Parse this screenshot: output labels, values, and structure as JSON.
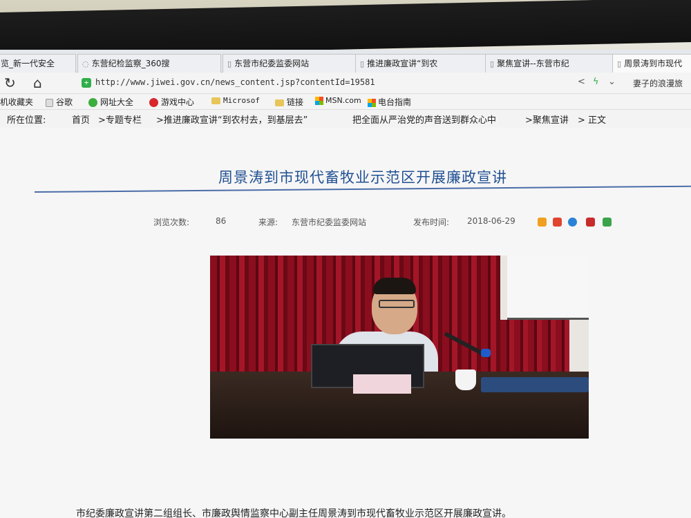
{
  "tabs": [
    {
      "label": "览_新一代安全"
    },
    {
      "label": "东营纪检监察_360搜"
    },
    {
      "label": "东营市纪委监委网站"
    },
    {
      "label": "推进廉政宣讲“到农"
    },
    {
      "label": "聚焦宣讲--东营市纪"
    },
    {
      "label": "周景涛到市现代"
    }
  ],
  "address_bar": {
    "url": "http://www.jiwei.gov.cn/news_content.jsp?contentId=19581"
  },
  "side_text": "妻子的浪漫旅",
  "bookmarks": [
    {
      "label": "机收藏夹"
    },
    {
      "label": "谷歌"
    },
    {
      "label": "网址大全"
    },
    {
      "label": "游戏中心"
    },
    {
      "label": "Microsof"
    },
    {
      "label": "链接"
    },
    {
      "label": "MSN.com"
    },
    {
      "label": "电台指南"
    }
  ],
  "breadcrumb": {
    "prefix": "所在位置:",
    "items": [
      "首页",
      ">专题专栏",
      ">推进廉政宣讲“到农村去，到基层去”",
      "把全面从严治党的声音送到群众心中",
      ">聚焦宣讲",
      "> 正文"
    ]
  },
  "article": {
    "title": "周景涛到市现代畜牧业示范区开展廉政宣讲",
    "views_label": "浏览次数:",
    "views": "86",
    "source_label": "来源:",
    "source": "东营市纪委监委网站",
    "date_label": "发布时间:",
    "date": "2018-06-29",
    "caption": "市纪委廉政宣讲第二组组长、市廉政舆情监察中心副主任周景涛到市现代畜牧业示范区开展廉政宣讲。"
  },
  "colors": {
    "title": "#1f4f92",
    "accent_rule": "#4a6ca8"
  }
}
